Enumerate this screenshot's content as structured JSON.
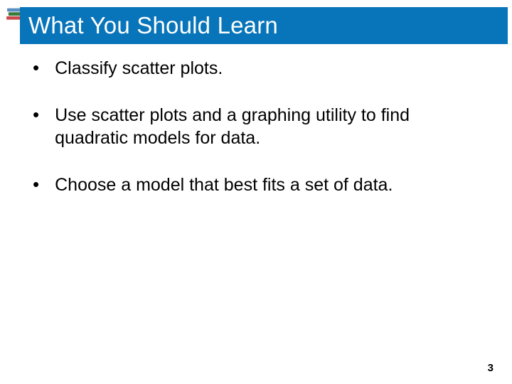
{
  "title": "What You Should Learn",
  "bullets": [
    "Classify scatter plots.",
    "Use scatter plots and a graphing utility to find quadratic models for data.",
    "Choose a model that best fits a set of data."
  ],
  "page_number": "3"
}
